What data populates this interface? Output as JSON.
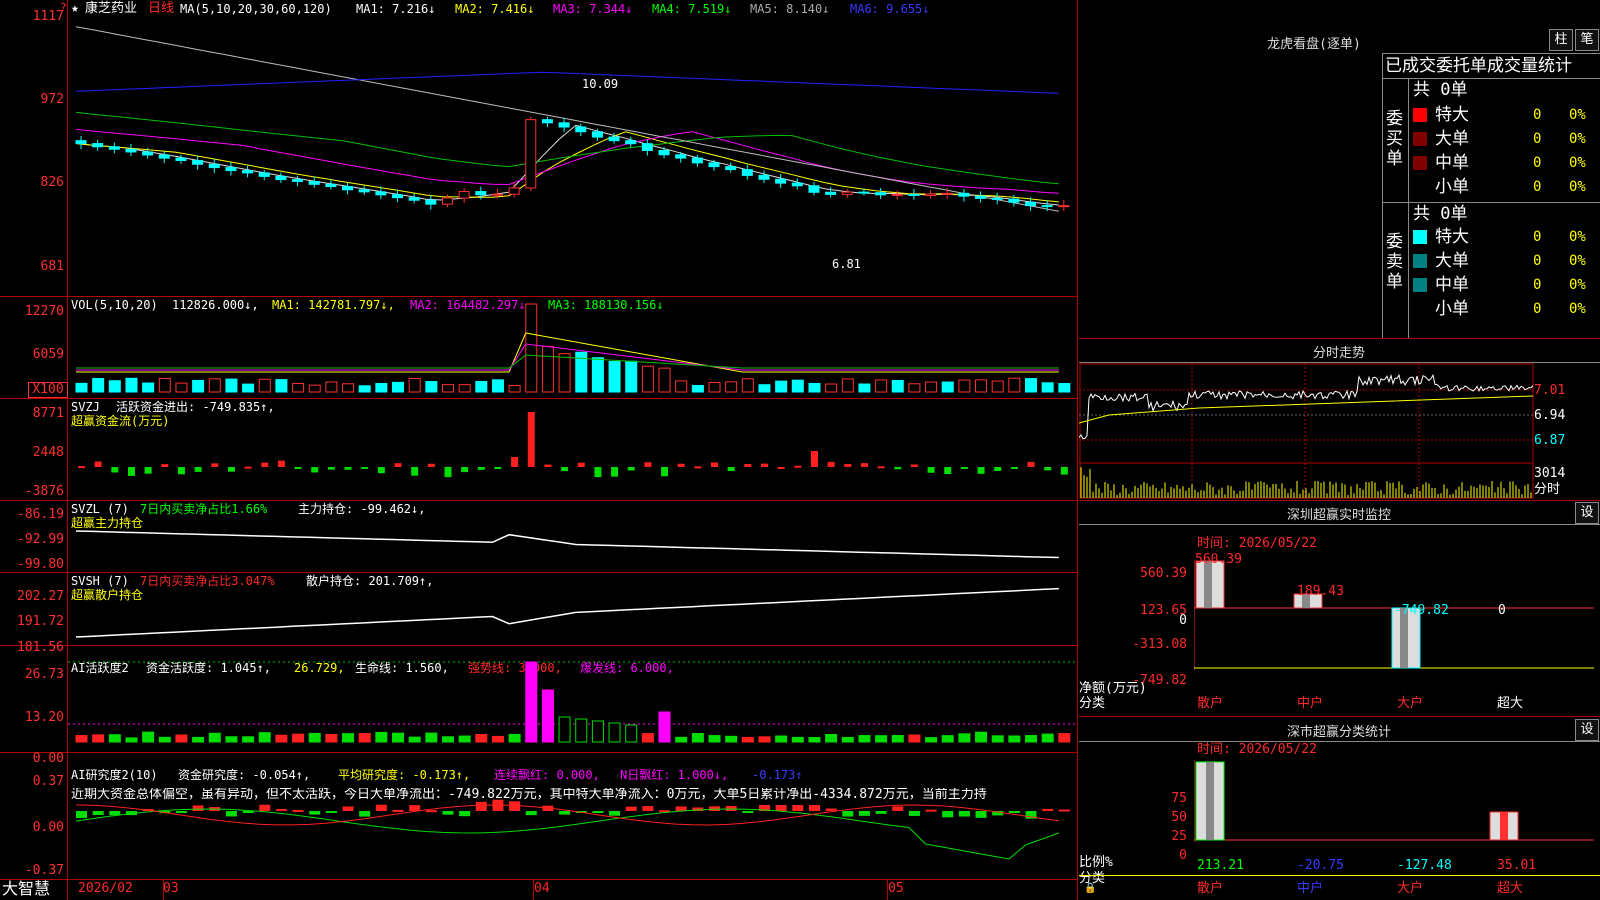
{
  "header": {
    "star": "★",
    "stock_name": "康芝药业",
    "period": "日线",
    "ma_prefix": "MA(5,10,20,30,60,120)",
    "ma1": "MA1: 7.216↓",
    "ma2": "MA2: 7.416↓",
    "ma3": "MA3: 7.344↓",
    "ma4": "MA4: 7.519↓",
    "ma5": "MA5: 8.140↓",
    "ma6": "MA6: 9.655↓",
    "high_label": "10.09",
    "low_label": "6.81",
    "corner_icon": "?"
  },
  "price_axis": [
    "1117",
    "972",
    "826",
    "681"
  ],
  "vol_panel": {
    "prefix": "VOL(5,10,20)",
    "vol": "112826.000↓,",
    "ma1": "MA1: 142781.797↓,",
    "ma2": "MA2: 164482.297↓,",
    "ma3": "MA3: 188130.156↓",
    "axis": [
      "12270",
      "6059",
      "X100"
    ]
  },
  "svzj_panel": {
    "prefix": "SVZJ",
    "label": "活跃资金进出: -749.835↑,",
    "subtitle": "超赢资金流(万元)",
    "axis": [
      "8771",
      "2448",
      "-3876"
    ]
  },
  "svzl_panel": {
    "prefix": "SVZL (7)",
    "label1": "7日内买卖净占比1.66%",
    "label2": "主力持仓: -99.462↓,",
    "subtitle": "超赢主力持仓",
    "axis": [
      "-86.19",
      "-92.99",
      "-99.80"
    ]
  },
  "svsh_panel": {
    "prefix": "SVSH (7)",
    "label1": "7日内买卖净占比3.047%",
    "label2": "散户持仓: 201.709↑,",
    "subtitle": "超赢散户持仓",
    "axis": [
      "202.27",
      "191.72",
      "181.56"
    ]
  },
  "ai_active_panel": {
    "prefix": "AI活跃度2",
    "label1": "资金活跃度: 1.045↑,",
    "label2": "26.729,",
    "label3": "生命线: 1.560,",
    "label4": "强势线: 3.000,",
    "label5": "爆发线: 6.000,",
    "axis": [
      "26.73",
      "13.20",
      "0.00"
    ]
  },
  "ai_research_panel": {
    "prefix": "AI研究度2(10)",
    "label1": "资金研究度: -0.054↑,",
    "label2": "平均研究度: -0.173↑,",
    "label3": "连续飘红: 0.000,",
    "label4": "N日飘红: 1.000↓,",
    "label5": "-0.173↑",
    "comment": "近期大资金总体偏空，虽有异动，但不太活跃，今日大单净流出：-749.822万元，其中特大单净流入：0万元，大单5日累计净出-4334.872万元，当前主力持",
    "axis": [
      "0.37",
      "0.00",
      "-0.37"
    ]
  },
  "footer": {
    "brand": "大智慧",
    "date": "2026/02",
    "months": [
      "03",
      "04",
      "05"
    ]
  },
  "dragon_tiger": {
    "title": "龙虎看盘(逐单)",
    "btn_zhu": "柱",
    "btn_bi": "笔",
    "table_title": "已成交委托单成交量统计",
    "buy_label": "委买单",
    "sell_label": "委卖单",
    "buy_total": "共 0单",
    "sell_total": "共 0单",
    "buy_rows": [
      {
        "name": "特大",
        "count": "0",
        "pct": "0%"
      },
      {
        "name": "大单",
        "count": "0",
        "pct": "0%"
      },
      {
        "name": "中单",
        "count": "0",
        "pct": "0%"
      },
      {
        "name": "小单",
        "count": "0",
        "pct": "0%"
      }
    ],
    "sell_rows": [
      {
        "name": "特大",
        "count": "0",
        "pct": "0%"
      },
      {
        "name": "大单",
        "count": "0",
        "pct": "0%"
      },
      {
        "name": "中单",
        "count": "0",
        "pct": "0%"
      },
      {
        "name": "小单",
        "count": "0",
        "pct": "0%"
      }
    ],
    "colors": {
      "buy": [
        "#ff0000",
        "#800000",
        "#800000",
        "#000000"
      ],
      "sell": [
        "#00ffff",
        "#008080",
        "#008080",
        "#000000"
      ]
    }
  },
  "intraday": {
    "title": "分时走势",
    "axis": [
      "7.01",
      "6.94",
      "6.87"
    ],
    "vol_axis": [
      "3014",
      "分时"
    ]
  },
  "sz_monitor": {
    "title": "深圳超赢实时监控",
    "btn": "设",
    "time_label": "时间: 2026/05/22",
    "axis": [
      "560.39",
      "123.65",
      "0",
      "-313.08",
      "-749.82"
    ],
    "bar_labels": [
      "560.39",
      "189.43",
      "-749.82",
      "0"
    ],
    "ylabel1": "净额(万元)",
    "ylabel2": "分类",
    "categories": [
      "散户",
      "中户",
      "大户",
      "超大"
    ]
  },
  "sz_stats": {
    "title": "深市超赢分类统计",
    "btn": "设",
    "time_label": "时间: 2026/05/22",
    "axis": [
      "75",
      "50",
      "25",
      "0"
    ],
    "ylabel1": "比例%",
    "ylabel2": "分类",
    "values": [
      "213.21",
      "-20.75",
      "-127.48",
      "35.01"
    ],
    "categories": [
      "散户",
      "中户",
      "大户",
      "超大"
    ]
  },
  "chart_data": {
    "type": "candlestick",
    "title": "康芝药业 日线",
    "y_axis_ticks": [
      11.17,
      9.72,
      8.26,
      6.81
    ],
    "annotations": [
      {
        "text": "10.09",
        "type": "high"
      },
      {
        "text": "6.81",
        "type": "low"
      }
    ],
    "x_month_labels": [
      "2026/02",
      "03",
      "04",
      "05"
    ]
  }
}
